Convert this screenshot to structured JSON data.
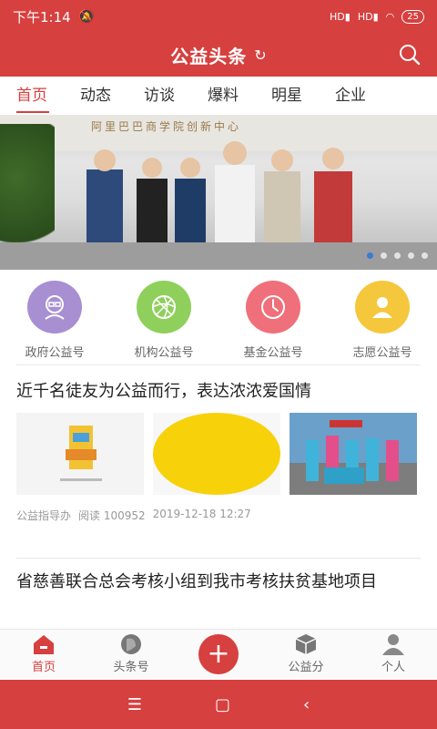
{
  "status": {
    "time": "下午1:14",
    "signal1": "HD",
    "signal2": "HD",
    "battery": "25"
  },
  "header": {
    "title": "公益头条",
    "refresh_icon": "refresh-icon",
    "search_icon": "search-icon"
  },
  "tabs": [
    "首页",
    "动态",
    "访谈",
    "爆料",
    "明星",
    "企业"
  ],
  "banner": {
    "wall_text": "阿里巴巴商学院创新中心",
    "active_dot": 0,
    "dot_count": 5
  },
  "categories": [
    {
      "label": "政府公益号",
      "color": "#a78fd2",
      "icon": "government-icon"
    },
    {
      "label": "机构公益号",
      "color": "#8fcf5c",
      "icon": "organization-icon"
    },
    {
      "label": "基金公益号",
      "color": "#ef6f7a",
      "icon": "fund-clock-icon"
    },
    {
      "label": "志愿公益号",
      "color": "#f5c73c",
      "icon": "volunteer-icon"
    }
  ],
  "articles": [
    {
      "title": "近千名徒友为公益而行，表达浓浓爱国情",
      "source": "公益指导办",
      "reads": "阅读 100952",
      "date": "2019-12-18 12:27"
    },
    {
      "title": "省慈善联合总会考核小组到我市考核扶贫基地项目"
    }
  ],
  "bottom_nav": [
    {
      "label": "首页",
      "icon": "home-icon",
      "active": true
    },
    {
      "label": "头条号",
      "icon": "avatar-icon",
      "active": false
    },
    {
      "label": "",
      "icon": "plus-icon",
      "active": false
    },
    {
      "label": "公益分",
      "icon": "box-icon",
      "active": false
    },
    {
      "label": "个人",
      "icon": "person-icon",
      "active": false
    }
  ],
  "colors": {
    "brand": "#d6403f"
  }
}
